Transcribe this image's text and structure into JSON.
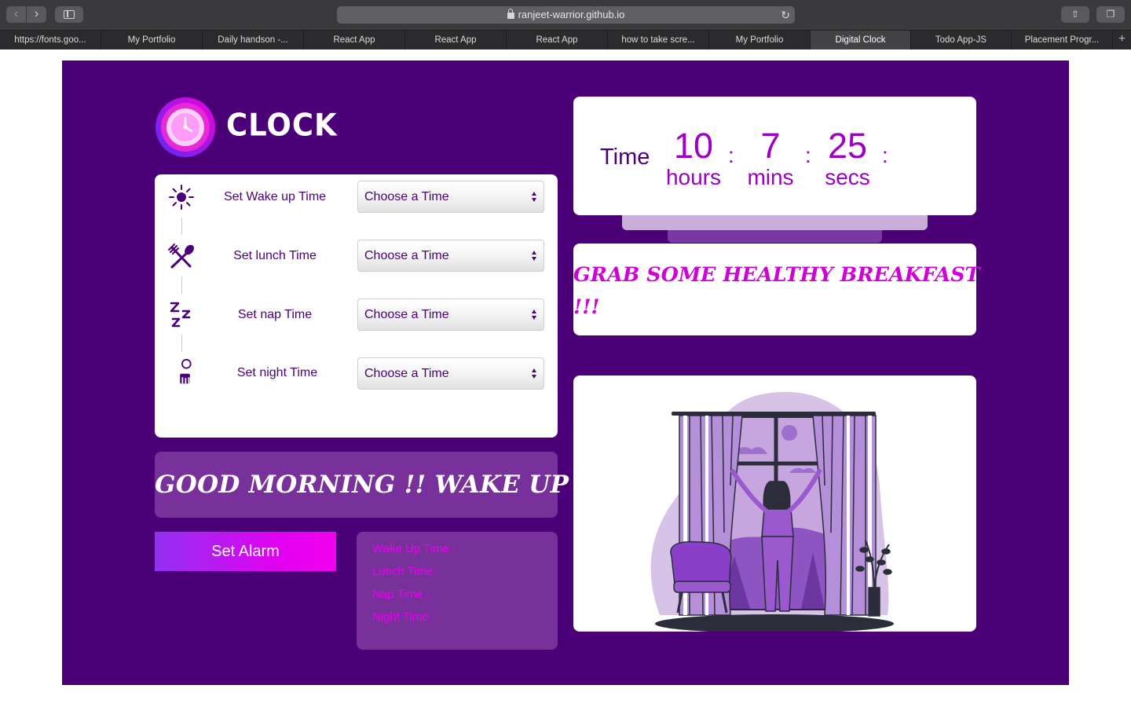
{
  "browser": {
    "url": "ranjeet-warrior.github.io",
    "back_glyph": "‹",
    "forward_glyph": "›",
    "reload_glyph": "↻",
    "share_glyph": "⇧",
    "tabs_glyph": "❐",
    "new_tab_glyph": "+",
    "tabs": [
      {
        "label": "https://fonts.goo..."
      },
      {
        "label": "My Portfolio"
      },
      {
        "label": "Daily handson -..."
      },
      {
        "label": "React App"
      },
      {
        "label": "React App"
      },
      {
        "label": "React App"
      },
      {
        "label": "how to take scre..."
      },
      {
        "label": "My Portfolio"
      },
      {
        "label": "Digital Clock"
      },
      {
        "label": "Todo App-JS"
      },
      {
        "label": "Placement Progr..."
      }
    ],
    "active_tab": "Digital Clock"
  },
  "app": {
    "title": "CLOCK"
  },
  "settings": [
    {
      "label": "Set Wake up Time",
      "icon": "sun-icon",
      "value": "Choose a Time"
    },
    {
      "label": "Set lunch Time",
      "icon": "fork-spoon-icon",
      "value": "Choose a Time"
    },
    {
      "label": "Set nap Time",
      "icon": "sleep-zzz-icon",
      "value": "Choose a Time"
    },
    {
      "label": "Set night Time",
      "icon": "moon-night-icon",
      "value": "Choose a Time"
    }
  ],
  "clock": {
    "label": "Time",
    "hours": "10",
    "hours_unit": "hours",
    "mins": "7",
    "mins_unit": "mins",
    "secs": "25",
    "secs_unit": "secs",
    "separator": ":"
  },
  "message": {
    "line1": "GRAB SOME HEALTHY BREAKFAST",
    "line2": "!!!"
  },
  "greeting": "GOOD MORNING !! WAKE UP !!",
  "alarm_button": "Set Alarm",
  "summary": {
    "wake": "Wake Up Time :",
    "lunch": "Lunch Time :",
    "nap": "Nap Time :",
    "night": "Night Time :"
  },
  "colors": {
    "page_bg": "#4b0077",
    "accent": "#9d00c4",
    "magenta": "#ea00f0",
    "panel_purple": "#78309b"
  }
}
